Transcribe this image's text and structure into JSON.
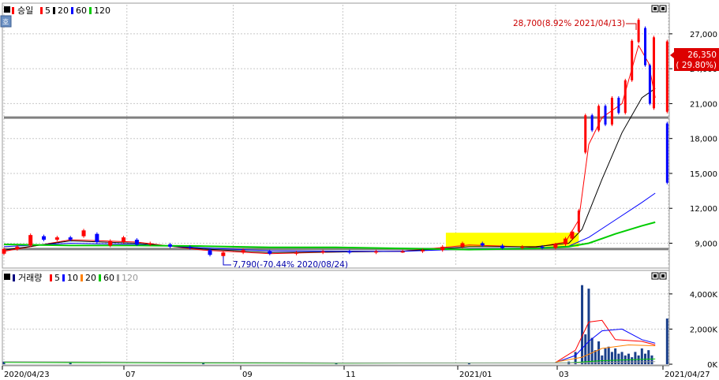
{
  "price_panel": {
    "legend": {
      "name": "승일",
      "ma_labels": [
        "5",
        "20",
        "60",
        "120"
      ]
    },
    "high_annotation": "28,700(8.92% 2021/04/13)",
    "low_annotation": "7,790(-70.44% 2020/08/24)",
    "current_price": "26,350",
    "current_change": "( 29.80%)",
    "y_ticks": [
      "27,000",
      "24,000",
      "21,000",
      "18,000",
      "15,000",
      "12,000",
      "9,000"
    ]
  },
  "volume_panel": {
    "legend": {
      "name": "거래량",
      "ma_labels": [
        "5",
        "10",
        "20",
        "60",
        "120"
      ]
    },
    "y_ticks": [
      "4,000K",
      "2,000K",
      "0K"
    ]
  },
  "x_axis": {
    "labels": [
      "2020/04/23",
      "07",
      "09",
      "11",
      "2021/01",
      "03",
      "2021/04/27"
    ]
  },
  "colors": {
    "up": "#ff0000",
    "down": "#0000ff",
    "ma5": "#ff0000",
    "ma20": "#000000",
    "ma60": "#0000ff",
    "ma120": "#00cc00",
    "vol_ma20": "#ff8000",
    "vol_ma120": "#999999",
    "highlight": "#ffff00",
    "hline": "#808080"
  },
  "chart_data": [
    {
      "type": "candlestick",
      "title": "승일",
      "x_range": [
        "2020/04/23",
        "2021/04/27"
      ],
      "ylim": [
        7000,
        29500
      ],
      "horizontal_lines": [
        19800,
        8500
      ],
      "highlight_band": {
        "from": "2020/12",
        "to": "2021/03",
        "y": [
          8700,
          9900
        ]
      },
      "series": [
        {
          "name": "price",
          "points": [
            {
              "t": 0.0,
              "o": 8100,
              "c": 8500
            },
            {
              "t": 0.02,
              "o": 8500,
              "c": 8700
            },
            {
              "t": 0.04,
              "o": 8800,
              "c": 9700
            },
            {
              "t": 0.06,
              "o": 9600,
              "c": 9300
            },
            {
              "t": 0.08,
              "o": 9300,
              "c": 9500
            },
            {
              "t": 0.1,
              "o": 9500,
              "c": 9300
            },
            {
              "t": 0.12,
              "o": 9600,
              "c": 10100
            },
            {
              "t": 0.14,
              "o": 9800,
              "c": 9100
            },
            {
              "t": 0.16,
              "o": 8800,
              "c": 9200
            },
            {
              "t": 0.18,
              "o": 9100,
              "c": 9500
            },
            {
              "t": 0.2,
              "o": 9300,
              "c": 8900
            },
            {
              "t": 0.22,
              "o": 8900,
              "c": 9000
            },
            {
              "t": 0.25,
              "o": 8900,
              "c": 8700
            },
            {
              "t": 0.28,
              "o": 8700,
              "c": 8600
            },
            {
              "t": 0.31,
              "o": 8400,
              "c": 8000
            },
            {
              "t": 0.33,
              "o": 7900,
              "c": 8200
            },
            {
              "t": 0.36,
              "o": 8200,
              "c": 8400
            },
            {
              "t": 0.4,
              "o": 8300,
              "c": 8100
            },
            {
              "t": 0.44,
              "o": 8100,
              "c": 8200
            },
            {
              "t": 0.48,
              "o": 8200,
              "c": 8300
            },
            {
              "t": 0.52,
              "o": 8300,
              "c": 8200
            },
            {
              "t": 0.56,
              "o": 8200,
              "c": 8300
            },
            {
              "t": 0.6,
              "o": 8300,
              "c": 8300
            },
            {
              "t": 0.63,
              "o": 8300,
              "c": 8400
            },
            {
              "t": 0.66,
              "o": 8400,
              "c": 8700
            },
            {
              "t": 0.69,
              "o": 8700,
              "c": 9000
            },
            {
              "t": 0.72,
              "o": 9000,
              "c": 8800
            },
            {
              "t": 0.75,
              "o": 8800,
              "c": 8600
            },
            {
              "t": 0.78,
              "o": 8600,
              "c": 8700
            },
            {
              "t": 0.81,
              "o": 8700,
              "c": 8600
            },
            {
              "t": 0.83,
              "o": 8600,
              "c": 8900
            },
            {
              "t": 0.845,
              "o": 8900,
              "c": 9400
            },
            {
              "t": 0.855,
              "o": 9400,
              "c": 10000
            },
            {
              "t": 0.865,
              "o": 10000,
              "c": 11800
            },
            {
              "t": 0.875,
              "o": 16800,
              "c": 20000
            },
            {
              "t": 0.885,
              "o": 20000,
              "c": 18700
            },
            {
              "t": 0.895,
              "o": 18700,
              "c": 20800
            },
            {
              "t": 0.905,
              "o": 20800,
              "c": 19200
            },
            {
              "t": 0.915,
              "o": 19200,
              "c": 21500
            },
            {
              "t": 0.925,
              "o": 21500,
              "c": 20200
            },
            {
              "t": 0.935,
              "o": 20200,
              "c": 23000
            },
            {
              "t": 0.945,
              "o": 23000,
              "c": 26400
            },
            {
              "t": 0.955,
              "o": 26300,
              "c": 28200
            },
            {
              "t": 0.965,
              "o": 27500,
              "c": 24300
            },
            {
              "t": 0.972,
              "o": 24300,
              "c": 21000
            },
            {
              "t": 0.978,
              "o": 20600,
              "c": 26700
            },
            {
              "t": 0.998,
              "o": 20300,
              "c": 26350
            },
            {
              "t": 0.998,
              "o": 19300,
              "c": 14200
            }
          ]
        },
        {
          "name": "5",
          "values": [
            [
              0,
              8300
            ],
            [
              0.1,
              9300
            ],
            [
              0.2,
              9100
            ],
            [
              0.3,
              8400
            ],
            [
              0.4,
              8100
            ],
            [
              0.5,
              8250
            ],
            [
              0.6,
              8300
            ],
            [
              0.7,
              8850
            ],
            [
              0.8,
              8650
            ],
            [
              0.845,
              9100
            ],
            [
              0.865,
              11000
            ],
            [
              0.88,
              17500
            ],
            [
              0.9,
              19800
            ],
            [
              0.93,
              21000
            ],
            [
              0.955,
              26000
            ],
            [
              0.97,
              24500
            ],
            [
              0.98,
              21500
            ]
          ]
        },
        {
          "name": "20",
          "values": [
            [
              0,
              8400
            ],
            [
              0.1,
              9200
            ],
            [
              0.2,
              9000
            ],
            [
              0.3,
              8500
            ],
            [
              0.4,
              8200
            ],
            [
              0.5,
              8250
            ],
            [
              0.6,
              8300
            ],
            [
              0.7,
              8700
            ],
            [
              0.8,
              8700
            ],
            [
              0.85,
              9000
            ],
            [
              0.87,
              10200
            ],
            [
              0.9,
              14500
            ],
            [
              0.93,
              18500
            ],
            [
              0.96,
              21500
            ],
            [
              0.98,
              22300
            ]
          ]
        },
        {
          "name": "60",
          "values": [
            [
              0,
              8700
            ],
            [
              0.1,
              9000
            ],
            [
              0.2,
              8900
            ],
            [
              0.3,
              8600
            ],
            [
              0.4,
              8350
            ],
            [
              0.5,
              8300
            ],
            [
              0.6,
              8300
            ],
            [
              0.7,
              8500
            ],
            [
              0.8,
              8600
            ],
            [
              0.85,
              8750
            ],
            [
              0.88,
              9500
            ],
            [
              0.92,
              11000
            ],
            [
              0.96,
              12500
            ],
            [
              0.98,
              13300
            ]
          ]
        },
        {
          "name": "120",
          "values": [
            [
              0,
              8900
            ],
            [
              0.1,
              8800
            ],
            [
              0.2,
              8800
            ],
            [
              0.3,
              8750
            ],
            [
              0.4,
              8650
            ],
            [
              0.5,
              8650
            ],
            [
              0.6,
              8550
            ],
            [
              0.7,
              8450
            ],
            [
              0.8,
              8550
            ],
            [
              0.85,
              8700
            ],
            [
              0.88,
              9000
            ],
            [
              0.92,
              9800
            ],
            [
              0.96,
              10500
            ],
            [
              0.98,
              10800
            ]
          ]
        }
      ]
    },
    {
      "type": "bar",
      "title": "거래량",
      "ylim": [
        0,
        4800000
      ],
      "series": [
        {
          "name": "volume",
          "values": [
            [
              0.0,
              150000
            ],
            [
              0.1,
              100000
            ],
            [
              0.3,
              80000
            ],
            [
              0.5,
              60000
            ],
            [
              0.7,
              90000
            ],
            [
              0.85,
              150000
            ],
            [
              0.86,
              700000
            ],
            [
              0.87,
              4500000
            ],
            [
              0.875,
              1700000
            ],
            [
              0.88,
              4300000
            ],
            [
              0.885,
              1500000
            ],
            [
              0.89,
              800000
            ],
            [
              0.895,
              1300000
            ],
            [
              0.9,
              500000
            ],
            [
              0.905,
              900000
            ],
            [
              0.91,
              1000000
            ],
            [
              0.915,
              700000
            ],
            [
              0.92,
              900000
            ],
            [
              0.925,
              600000
            ],
            [
              0.93,
              700000
            ],
            [
              0.935,
              500000
            ],
            [
              0.94,
              600000
            ],
            [
              0.945,
              400000
            ],
            [
              0.95,
              700000
            ],
            [
              0.955,
              500000
            ],
            [
              0.96,
              900000
            ],
            [
              0.965,
              600000
            ],
            [
              0.97,
              800000
            ],
            [
              0.975,
              500000
            ],
            [
              0.998,
              2600000
            ]
          ]
        },
        {
          "name": "5",
          "values": [
            [
              0.83,
              100000
            ],
            [
              0.86,
              800000
            ],
            [
              0.88,
              2400000
            ],
            [
              0.9,
              2500000
            ],
            [
              0.92,
              1400000
            ],
            [
              0.96,
              1300000
            ],
            [
              0.98,
              1100000
            ]
          ]
        },
        {
          "name": "10",
          "values": [
            [
              0.83,
              100000
            ],
            [
              0.86,
              500000
            ],
            [
              0.88,
              1300000
            ],
            [
              0.9,
              1900000
            ],
            [
              0.93,
              2000000
            ],
            [
              0.96,
              1400000
            ],
            [
              0.98,
              1200000
            ]
          ]
        },
        {
          "name": "20",
          "values": [
            [
              0.83,
              120000
            ],
            [
              0.87,
              400000
            ],
            [
              0.9,
              900000
            ],
            [
              0.94,
              1100000
            ],
            [
              0.98,
              1050000
            ]
          ]
        },
        {
          "name": "60",
          "values": [
            [
              0.0,
              100000
            ],
            [
              0.5,
              60000
            ],
            [
              0.85,
              80000
            ],
            [
              0.9,
              200000
            ],
            [
              0.98,
              300000
            ]
          ]
        },
        {
          "name": "120",
          "values": [
            [
              0.0,
              150000
            ],
            [
              0.5,
              80000
            ],
            [
              0.85,
              70000
            ],
            [
              0.98,
              150000
            ]
          ]
        }
      ]
    }
  ]
}
